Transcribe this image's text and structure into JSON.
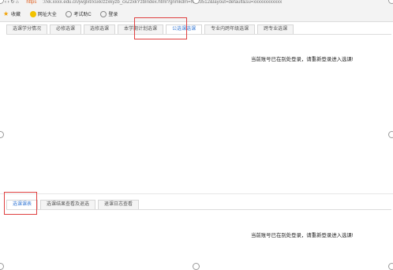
{
  "browser": {
    "nav_icons": "‹ › ↻ ⌂",
    "secure_label": "https",
    "url": "://xk.xxxx.edu.cn/jwglxt/xsxk/zzxkyzb_cxZzxkYzbIndex.html?gnmkdm=N253512&layout=default&su=xxxxxxxxxxxx",
    "bookmarks": [
      {
        "label": "收藏",
        "icon": "star-icon"
      },
      {
        "label": "网址大全",
        "icon": "wang-icon"
      },
      {
        "label": "考试助C",
        "icon": "globe-icon"
      },
      {
        "label": "登录",
        "icon": "globe-icon"
      }
    ]
  },
  "top_tabs": [
    {
      "label": "选课学分情况"
    },
    {
      "label": "必修选课"
    },
    {
      "label": "选修选课"
    },
    {
      "label": "本学期计划选课"
    },
    {
      "label": "公选课选课"
    },
    {
      "label": "专业内跨年级选课"
    },
    {
      "label": "跨专业选课"
    }
  ],
  "top_active_index": 4,
  "top_message": "当前账号已在别处登录，请重新登录进入选课!",
  "bottom_tabs": [
    {
      "label": "选课课表"
    },
    {
      "label": "选课结果查看及退选"
    },
    {
      "label": "退课日志查看"
    }
  ],
  "bottom_active_index": 0,
  "bottom_message": "当前账号已在别处登录，请重新登录进入选课!",
  "colors": {
    "active_tab": "#3a7bd5",
    "highlight": "#e04040"
  }
}
